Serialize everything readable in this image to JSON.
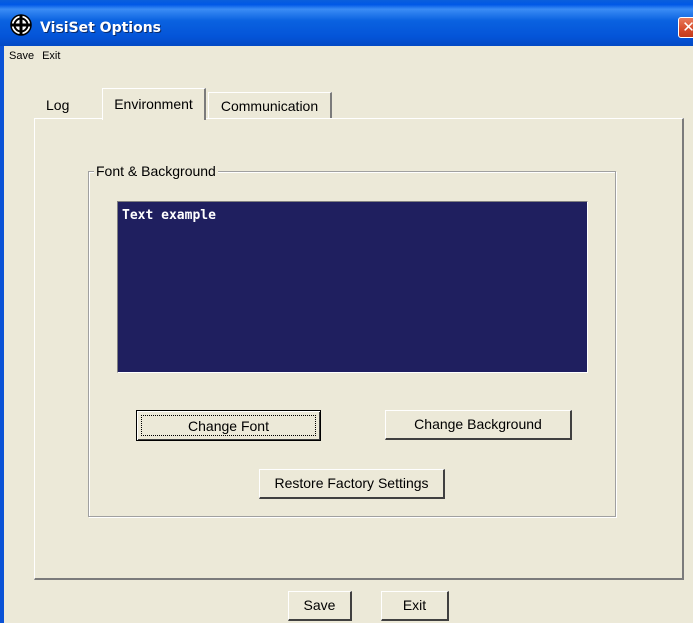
{
  "window": {
    "title": "VisiSet Options",
    "close_glyph": "✕"
  },
  "menu": {
    "save": "Save",
    "exit": "Exit"
  },
  "tabs": {
    "log": "Log",
    "environment": "Environment",
    "communication": "Communication",
    "active": "environment"
  },
  "group": {
    "legend": "Font & Background"
  },
  "preview": {
    "text": "Text example",
    "background_color": "#1f1f5f",
    "text_color": "#ffffff"
  },
  "buttons": {
    "change_font": "Change Font",
    "change_background": "Change Background",
    "restore_factory": "Restore Factory Settings",
    "save": "Save",
    "exit": "Exit"
  },
  "icons": {
    "app_icon": "crosshair-compass-icon",
    "close_icon": "close-icon"
  }
}
